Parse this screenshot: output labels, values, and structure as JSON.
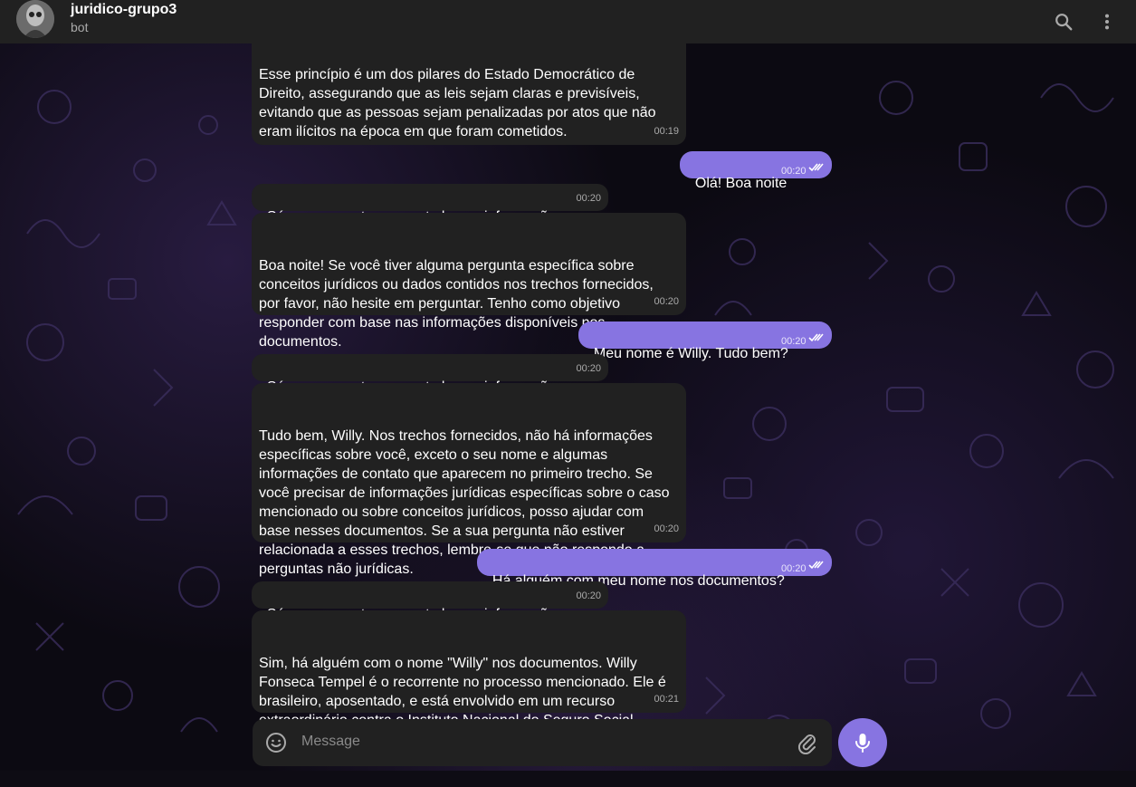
{
  "header": {
    "title": "juridico-grupo3",
    "subtitle": "bot"
  },
  "messages": [
    {
      "text": "Esse princípio é um dos pilares do Estado Democrático de\nDireito, assegurando que as leis sejam claras e previsíveis,\nevitando que as pessoas sejam penalizadas por atos que não\neram ilícitos na época em que foram cometidos.",
      "time": "00:19"
    },
    {
      "text": "Olá! Boa noite",
      "time": "00:20"
    },
    {
      "text": "Só um momento enquanto busco informações...",
      "time": "00:20"
    },
    {
      "text": "Boa noite! Se você tiver alguma pergunta específica sobre\nconceitos jurídicos ou dados contidos nos trechos fornecidos,\npor favor, não hesite em perguntar. Tenho como objetivo\nresponder com base nas informações disponíveis nos\ndocumentos.",
      "time": "00:20"
    },
    {
      "text": "Meu nome é Willy. Tudo bem?",
      "time": "00:20"
    },
    {
      "text": "Só um momento enquanto busco informações...",
      "time": "00:20"
    },
    {
      "text": "Tudo bem, Willy. Nos trechos fornecidos, não há informações\nespecíficas sobre você, exceto o seu nome e algumas\ninformações de contato que aparecem no primeiro trecho. Se\nvocê precisar de informações jurídicas específicas sobre o caso\nmencionado ou sobre conceitos jurídicos, posso ajudar com\nbase nesses documentos. Se a sua pergunta não estiver\nrelacionada a esses trechos, lembre-se que não respondo a\nperguntas não jurídicas.",
      "time": "00:20"
    },
    {
      "text": "Há alguém com meu nome nos documentos?",
      "time": "00:20"
    },
    {
      "text": "Só um momento enquanto busco informações...",
      "time": "00:20"
    },
    {
      "text": "Sim, há alguém com o nome \"Willy\" nos documentos. Willy\nFonseca Tempel é o recorrente no processo mencionado. Ele é\nbrasileiro, aposentado, e está envolvido em um recurso\nextraordinário contra o Instituto Nacional do Seguro Social\n(INSS).",
      "time": "00:21"
    }
  ],
  "composer": {
    "placeholder": "Message"
  },
  "icons": {
    "search": "search-icon",
    "menu": "more-vertical-icon",
    "emoji": "emoji-icon",
    "attach": "paperclip-icon",
    "mic": "microphone-icon",
    "read": "double-check-icon"
  },
  "colors": {
    "header_bg": "#212121",
    "incoming_bubble": "#212121",
    "outgoing_bubble": "#8774e1",
    "accent": "#8774e1"
  }
}
